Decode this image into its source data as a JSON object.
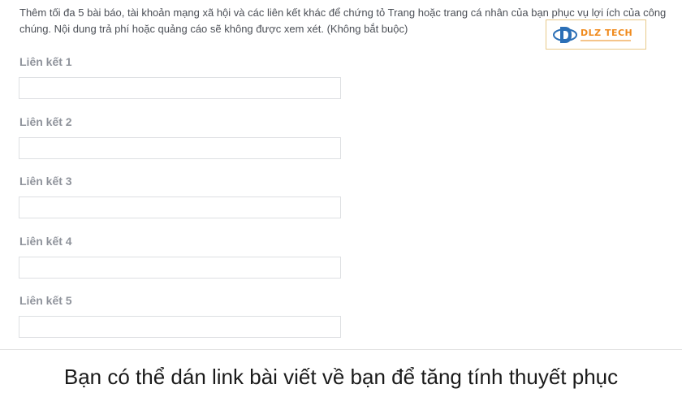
{
  "form": {
    "description": "Thêm tối đa 5 bài báo, tài khoản mạng xã hội và các liên kết khác để chứng tỏ Trang hoặc trang cá nhân của bạn phục vụ lợi ích của công chúng. Nội dung trả phí hoặc quảng cáo sẽ không được xem xét. (Không bắt buộc)",
    "fields": [
      {
        "label": "Liên kết 1",
        "value": ""
      },
      {
        "label": "Liên kết 2",
        "value": ""
      },
      {
        "label": "Liên kết 3",
        "value": ""
      },
      {
        "label": "Liên kết 4",
        "value": ""
      },
      {
        "label": "Liên kết 5",
        "value": ""
      }
    ]
  },
  "watermark": {
    "name": "DLZ TECH",
    "icon": "dlz-logo-icon",
    "accent_color": "#f08a1c",
    "secondary_color": "#2b6fb6"
  },
  "caption": "Bạn có thể dán link bài viết về bạn để tăng tính thuyết phục"
}
